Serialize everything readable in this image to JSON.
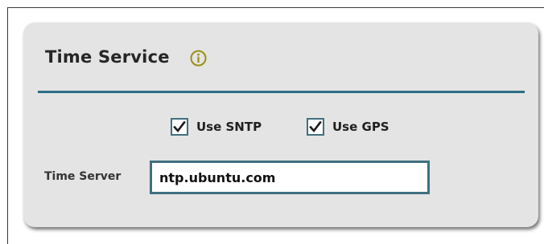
{
  "panel": {
    "title": "Time Service",
    "accent_color": "#2b6e85",
    "info_icon_color": "#9a8f12"
  },
  "options": {
    "sntp": {
      "label": "Use SNTP",
      "checked": true
    },
    "gps": {
      "label": "Use GPS",
      "checked": true
    }
  },
  "time_server": {
    "label": "Time Server",
    "value": "ntp.ubuntu.com"
  }
}
